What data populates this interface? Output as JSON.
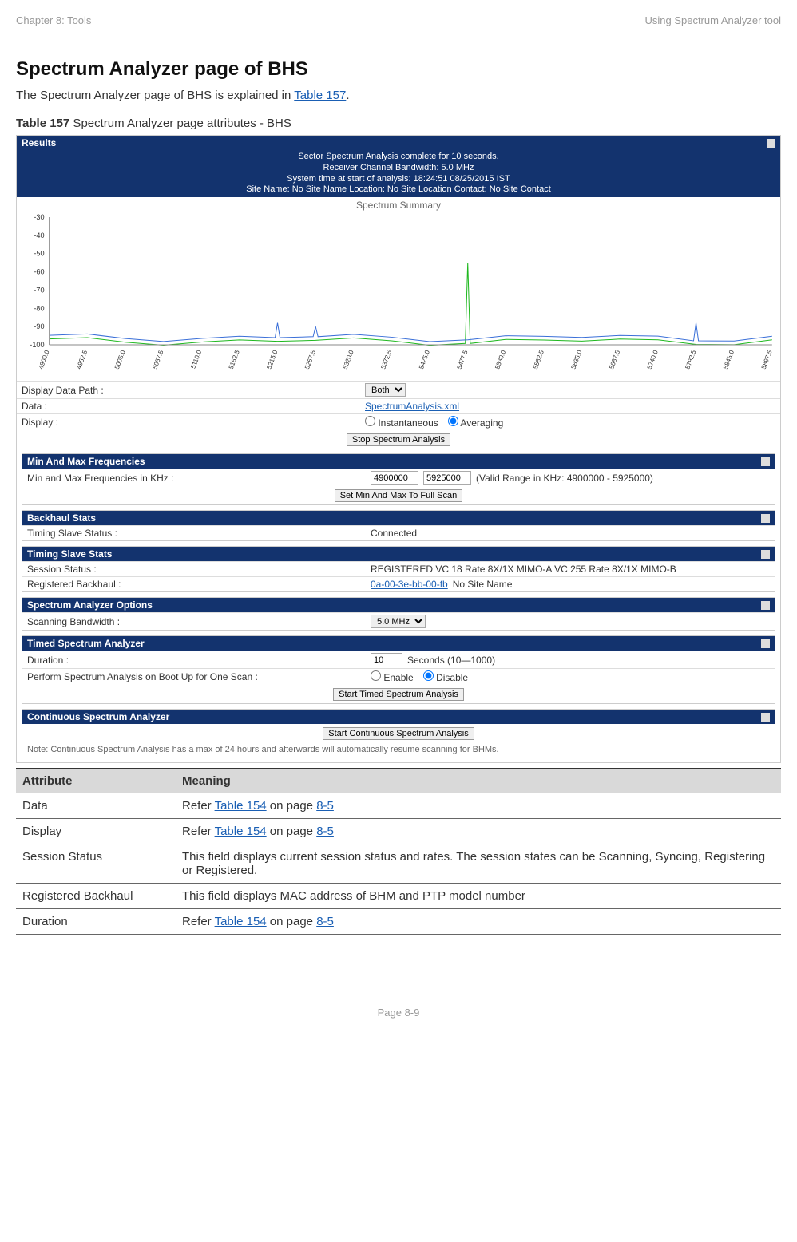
{
  "header": {
    "left": "Chapter 8:  Tools",
    "right": "Using Spectrum Analyzer tool"
  },
  "heading": "Spectrum Analyzer page of BHS",
  "intro": {
    "pre": "The Spectrum Analyzer page of BHS is explained in ",
    "link": "Table 157",
    "post": "."
  },
  "caption": {
    "bold": "Table 157",
    "rest": " Spectrum Analyzer page attributes - BHS"
  },
  "results": {
    "title": "Results",
    "lines": [
      "Sector Spectrum Analysis complete for 10 seconds.",
      "Receiver Channel Bandwidth: 5.0 MHz",
      "System time at start of analysis: 18:24:51 08/25/2015 IST",
      "Site Name: No Site Name  Location: No Site Location  Contact: No Site Contact"
    ],
    "chartTitle": "Spectrum Summary",
    "rows": {
      "dataPath": {
        "label": "Display Data Path :",
        "select": "Both"
      },
      "data": {
        "label": "Data :",
        "link": "SpectrumAnalysis.xml"
      },
      "display": {
        "label": "Display :",
        "opt1": "Instantaneous",
        "opt2": "Averaging"
      }
    },
    "stopBtn": "Stop Spectrum Analysis"
  },
  "minmax": {
    "title": "Min And Max Frequencies",
    "label": "Min and Max Frequencies in KHz :",
    "v1": "4900000",
    "v2": "5925000",
    "hint": "(Valid Range in KHz: 4900000 - 5925000)",
    "btn": "Set Min And Max To Full Scan"
  },
  "backhaul": {
    "title": "Backhaul Stats",
    "label": "Timing Slave Status :",
    "val": "Connected"
  },
  "timing": {
    "title": "Timing Slave Stats",
    "sess": {
      "label": "Session Status :",
      "val": "REGISTERED VC 18 Rate 8X/1X MIMO-A VC 255 Rate 8X/1X MIMO-B"
    },
    "reg": {
      "label": "Registered Backhaul :",
      "mac": "0a-00-3e-bb-00-fb",
      "tail": " No Site Name"
    }
  },
  "options": {
    "title": "Spectrum Analyzer Options",
    "label": "Scanning Bandwidth :",
    "select": "5.0 MHz"
  },
  "timed": {
    "title": "Timed Spectrum Analyzer",
    "dur": {
      "label": "Duration :",
      "val": "10",
      "hint": "Seconds (10—1000)"
    },
    "boot": {
      "label": "Perform Spectrum Analysis on Boot Up for One Scan :",
      "opt1": "Enable",
      "opt2": "Disable"
    },
    "btn": "Start Timed Spectrum Analysis"
  },
  "cont": {
    "title": "Continuous Spectrum Analyzer",
    "btn": "Start Continuous Spectrum Analysis",
    "note": "Note: Continuous Spectrum Analysis has a max of 24 hours and afterwards will automatically resume scanning for BHMs."
  },
  "attrTable": {
    "h1": "Attribute",
    "h2": "Meaning",
    "rows": [
      {
        "a": "Data",
        "pre": "Refer ",
        "link": "Table 154",
        "mid": " on page ",
        "link2": "8-5"
      },
      {
        "a": "Display",
        "pre": "Refer ",
        "link": "Table 154",
        "mid": " on page ",
        "link2": "8-5"
      },
      {
        "a": "Session Status",
        "plain": "This field displays current session status and rates. The session states can be Scanning, Syncing, Registering or Registered."
      },
      {
        "a": "Registered Backhaul",
        "plain": "This field displays MAC address of BHM and PTP model number"
      },
      {
        "a": "Duration",
        "pre": "Refer ",
        "link": "Table 154",
        "mid": " on page ",
        "link2": "8-5"
      }
    ]
  },
  "footer": "Page 8-9",
  "chart_data": {
    "type": "line",
    "title": "Spectrum Summary",
    "xlabel": "",
    "ylabel": "",
    "ylim": [
      -100,
      -30
    ],
    "yticks": [
      -30,
      -40,
      -50,
      -60,
      -70,
      -80,
      -90,
      -100
    ],
    "xticks": [
      "4900.0",
      "4952.5",
      "5005.0",
      "5057.5",
      "5110.0",
      "5162.5",
      "5215.0",
      "5267.5",
      "5320.0",
      "5372.5",
      "5425.0",
      "5477.5",
      "5530.0",
      "5582.5",
      "5635.0",
      "5687.5",
      "5740.0",
      "5792.5",
      "5845.0",
      "5897.5"
    ],
    "series": [
      {
        "name": "green",
        "baseline": -98,
        "spikes": [
          {
            "x": "5477.5",
            "peak": -55
          }
        ]
      },
      {
        "name": "blue",
        "baseline": -96,
        "spikes": [
          {
            "x": "5215.0",
            "peak": -88
          },
          {
            "x": "5267.5",
            "peak": -90
          },
          {
            "x": "5792.5",
            "peak": -88
          }
        ]
      }
    ]
  }
}
